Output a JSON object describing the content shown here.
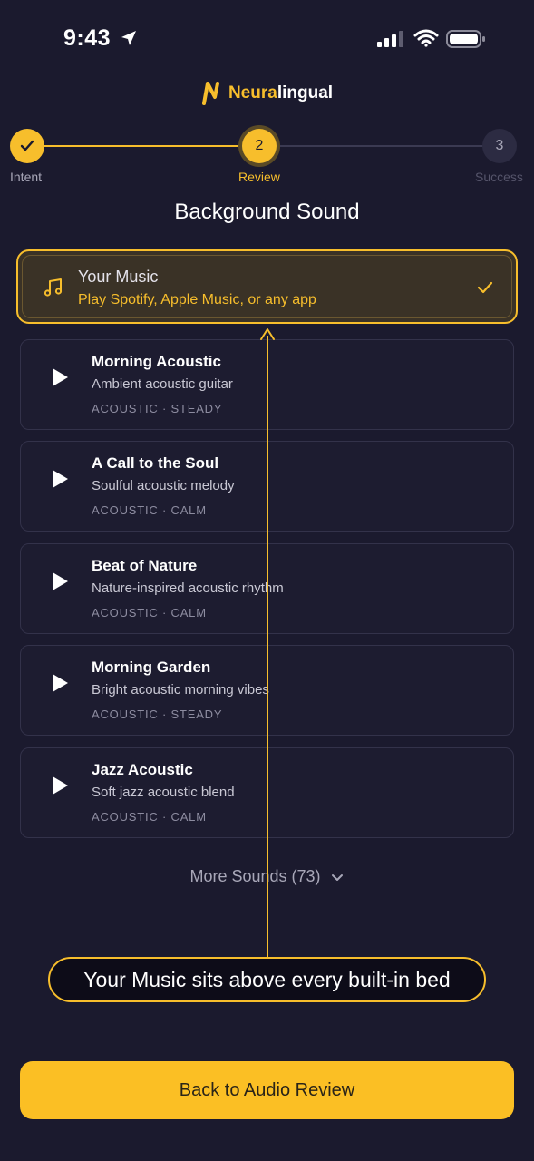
{
  "status_bar": {
    "time": "9:43"
  },
  "brand": {
    "name_part1": "Neura",
    "name_part2": "lingual"
  },
  "stepper": {
    "steps": [
      {
        "label": "Intent",
        "state": "done",
        "number": "1"
      },
      {
        "label": "Review",
        "state": "active",
        "number": "2"
      },
      {
        "label": "Success",
        "state": "todo",
        "number": "3"
      }
    ]
  },
  "page": {
    "title": "Background Sound"
  },
  "your_music": {
    "title": "Your Music",
    "subtitle": "Play Spotify, Apple Music, or any app",
    "selected": true
  },
  "sounds": [
    {
      "title": "Morning Acoustic",
      "desc": "Ambient acoustic guitar",
      "tags": "ACOUSTIC · STEADY"
    },
    {
      "title": "A Call to the Soul",
      "desc": "Soulful acoustic melody",
      "tags": "ACOUSTIC · CALM"
    },
    {
      "title": "Beat of Nature",
      "desc": "Nature-inspired acoustic rhythm",
      "tags": "ACOUSTIC · CALM"
    },
    {
      "title": "Morning Garden",
      "desc": "Bright acoustic morning vibes",
      "tags": "ACOUSTIC · STEADY"
    },
    {
      "title": "Jazz Acoustic",
      "desc": "Soft jazz acoustic blend",
      "tags": "ACOUSTIC · CALM"
    }
  ],
  "more_sounds": {
    "label": "More Sounds (73)"
  },
  "annotation": {
    "text": "Your Music sits above every built-in bed"
  },
  "footer": {
    "back_label": "Back to Audio Review"
  },
  "colors": {
    "accent": "#fbbf24",
    "background": "#1b1a2e"
  }
}
